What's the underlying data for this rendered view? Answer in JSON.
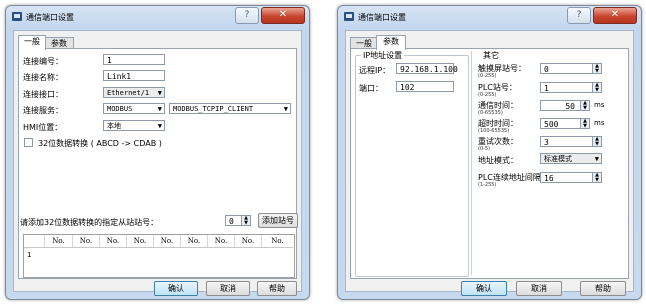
{
  "left_dialog": {
    "title": "通信端口设置",
    "help_glyph": "?",
    "close_glyph": "✕",
    "tabs": [
      "一般",
      "参数"
    ],
    "fields": {
      "link_no_label": "连接编号：",
      "link_no_value": "1",
      "link_name_label": "连接名称：",
      "link_name_value": "Link1",
      "link_port_label": "连接接口：",
      "link_port_value": "Ethernet/1",
      "link_service_label": "连接服务：",
      "link_service_value": "MODBUS",
      "link_service_mode_value": "MODBUS_TCPIP_CLIENT",
      "hmi_pos_label": "HMI位置：",
      "hmi_pos_value": "本地",
      "convert_label": "32位数据转换 ( ABCD -> CDAB )"
    },
    "slave": {
      "prompt": "请添加32位数据转换的指定从站站号：",
      "value": "0",
      "add_button": "添加站号"
    },
    "table": {
      "headers": [
        "No.",
        "No.",
        "No.",
        "No.",
        "No.",
        "No.",
        "No.",
        "No.",
        "No."
      ],
      "rows": [
        [
          "1"
        ]
      ]
    },
    "buttons": {
      "ok": "确认",
      "cancel": "取消",
      "help": "帮助"
    }
  },
  "right_dialog": {
    "title": "通信端口设置",
    "help_glyph": "?",
    "close_glyph": "✕",
    "tabs": [
      "一般",
      "参数"
    ],
    "ip_group": {
      "title": "IP地址设置",
      "remote_ip_label": "远程IP：",
      "remote_ip_value": "92.168.1.100",
      "port_label": "端口：",
      "port_value": "102"
    },
    "other_group": {
      "title": "其它",
      "screen_station_label": "触摸屏站号：",
      "screen_station_range": "(0-255)",
      "screen_station_value": "0",
      "plc_station_label": "PLC站号：",
      "plc_station_range": "(0-255)",
      "plc_station_value": "1",
      "comm_time_label": "通信时间：",
      "comm_time_range": "(0-65535)",
      "comm_time_value": "50",
      "comm_time_unit": "ms",
      "timeout_label": "超时时间：",
      "timeout_range": "(100-65535)",
      "timeout_value": "500",
      "timeout_unit": "ms",
      "retry_label": "重试次数：",
      "retry_range": "(0-5)",
      "retry_value": "3",
      "addr_mode_label": "地址模式：",
      "addr_mode_value": "标准模式",
      "plc_interval_label": "PLC连续地址间隔",
      "plc_interval_range": "(1-255)",
      "plc_interval_value": "16"
    },
    "buttons": {
      "ok": "确认",
      "cancel": "取消",
      "help": "帮助"
    }
  }
}
